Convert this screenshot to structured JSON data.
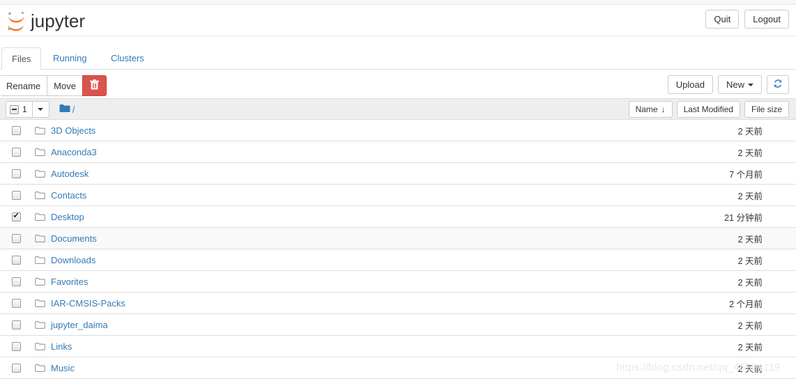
{
  "header": {
    "brand": "jupyter",
    "logo_icon": "jupyter-logo",
    "quit_label": "Quit",
    "logout_label": "Logout"
  },
  "tabs": [
    {
      "label": "Files",
      "active": true
    },
    {
      "label": "Running",
      "active": false
    },
    {
      "label": "Clusters",
      "active": false
    }
  ],
  "toolbar": {
    "rename_label": "Rename",
    "move_label": "Move",
    "delete_icon": "trash-icon",
    "upload_label": "Upload",
    "new_label": "New",
    "new_caret_icon": "caret-down-icon",
    "refresh_icon": "refresh-icon"
  },
  "listbar": {
    "selection_count": "1",
    "selection_state": "indeterminate",
    "selection_caret_icon": "caret-down-icon",
    "breadcrumb_icon": "folder-icon",
    "breadcrumb_path": "/",
    "sort_name": "Name",
    "sort_name_arrow": "↓",
    "sort_last_modified": "Last Modified",
    "sort_file_size": "File size"
  },
  "files": [
    {
      "name": "3D Objects",
      "modified": "2 天前",
      "checked": false,
      "hover": false
    },
    {
      "name": "Anaconda3",
      "modified": "2 天前",
      "checked": false,
      "hover": false
    },
    {
      "name": "Autodesk",
      "modified": "7 个月前",
      "checked": false,
      "hover": false
    },
    {
      "name": "Contacts",
      "modified": "2 天前",
      "checked": false,
      "hover": false
    },
    {
      "name": "Desktop",
      "modified": "21 分钟前",
      "checked": true,
      "hover": false
    },
    {
      "name": "Documents",
      "modified": "2 天前",
      "checked": false,
      "hover": true
    },
    {
      "name": "Downloads",
      "modified": "2 天前",
      "checked": false,
      "hover": false
    },
    {
      "name": "Favorites",
      "modified": "2 天前",
      "checked": false,
      "hover": false
    },
    {
      "name": "IAR-CMSIS-Packs",
      "modified": "2 个月前",
      "checked": false,
      "hover": false
    },
    {
      "name": "jupyter_daima",
      "modified": "2 天前",
      "checked": false,
      "hover": false
    },
    {
      "name": "Links",
      "modified": "2 天前",
      "checked": false,
      "hover": false
    },
    {
      "name": "Music",
      "modified": "2 天前",
      "checked": false,
      "hover": false
    }
  ],
  "watermark": "https://blog.csdn.net/qq_45504119",
  "colors": {
    "link": "#337ab7",
    "logo_orange": "#f37726",
    "danger": "#d9534f",
    "bar_bg": "#eeeeee",
    "border": "#dddddd"
  }
}
